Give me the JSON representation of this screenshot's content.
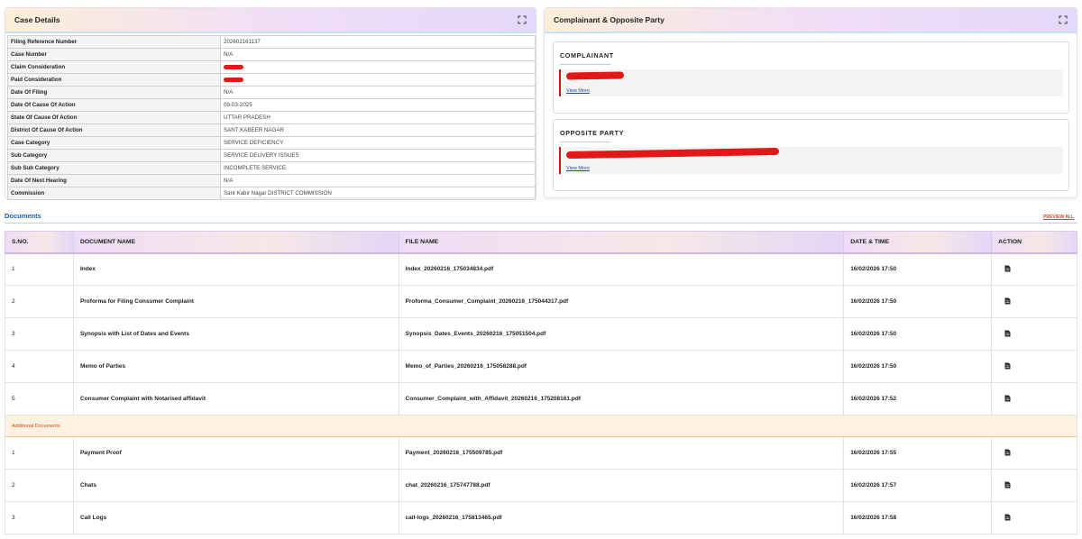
{
  "case_details": {
    "title": "Case Details",
    "rows": [
      {
        "label": "Filing Reference Number",
        "value": "202602161137"
      },
      {
        "label": "Case Number",
        "value": "N/A"
      },
      {
        "label": "Claim Consideration",
        "value": ""
      },
      {
        "label": "Paid Consideration",
        "value": ""
      },
      {
        "label": "Date Of Filing",
        "value": "N/A"
      },
      {
        "label": "Date Of Cause Of Action",
        "value": "09-03-2025"
      },
      {
        "label": "State Of Cause Of Action",
        "value": "UTTAR PRADESH"
      },
      {
        "label": "District Of Cause Of Action",
        "value": "SANT KABEER NAGAR"
      },
      {
        "label": "Case Category",
        "value": "SERVICE DEFICIENCY"
      },
      {
        "label": "Sub Category",
        "value": "SERVICE DELIVERY ISSUES"
      },
      {
        "label": "Sub Sub Category",
        "value": "INCOMPLETE SERVICE"
      },
      {
        "label": "Date Of Next Hearing",
        "value": "N/A"
      },
      {
        "label": "Commission",
        "value": "Sant Kabir Nagar DISTRICT COMMISSION"
      }
    ]
  },
  "parties": {
    "title": "Complainant & Opposite Party",
    "complainant": {
      "heading": "COMPLAINANT",
      "view_more": "View More"
    },
    "opposite_party": {
      "heading": "OPPOSITE PARTY",
      "view_more": "View More"
    }
  },
  "documents": {
    "title": "Documents",
    "preview_all": "PREVIEW ALL",
    "columns": [
      "S.NO.",
      "DOCUMENT NAME",
      "FILE NAME",
      "DATE & TIME",
      "ACTION"
    ],
    "rows": [
      {
        "sno": "1",
        "name": "Index",
        "file": "Index_20260216_175034834.pdf",
        "datetime": "16/02/2026 17:50"
      },
      {
        "sno": "2",
        "name": "Proforma for Filing Consumer Complaint",
        "file": "Proforma_Consumer_Complaint_20260216_175044317.pdf",
        "datetime": "16/02/2026 17:50"
      },
      {
        "sno": "3",
        "name": "Synopsis with List of Dates and Events",
        "file": "Synopsis_Dates_Events_20260216_175051504.pdf",
        "datetime": "16/02/2026 17:50"
      },
      {
        "sno": "4",
        "name": "Memo of Parties",
        "file": "Memo_of_Parties_20260216_175058288.pdf",
        "datetime": "16/02/2026 17:50"
      },
      {
        "sno": "5",
        "name": "Consumer Complaint with Notarised affidavit",
        "file": "Consumer_Complaint_with_Affidavit_20260216_175208161.pdf",
        "datetime": "16/02/2026 17:52"
      }
    ],
    "additional_label": "Additional Documents",
    "additional_rows": [
      {
        "sno": "1",
        "name": "Payment Proof",
        "file": "Payment_20260216_175509785.pdf",
        "datetime": "16/02/2026 17:55"
      },
      {
        "sno": "2",
        "name": "Chats",
        "file": "chat_20260216_175747788.pdf",
        "datetime": "16/02/2026 17:57"
      },
      {
        "sno": "3",
        "name": "Call Logs",
        "file": "call-logs_20260216_175813465.pdf",
        "datetime": "16/02/2026 17:58"
      }
    ]
  },
  "icons": {
    "expand": "expand-icon",
    "document": "file-icon"
  },
  "colors": {
    "accent_blue": "#1a5fb4",
    "accent_orange": "#d14a1a",
    "redaction": "#e01818"
  }
}
